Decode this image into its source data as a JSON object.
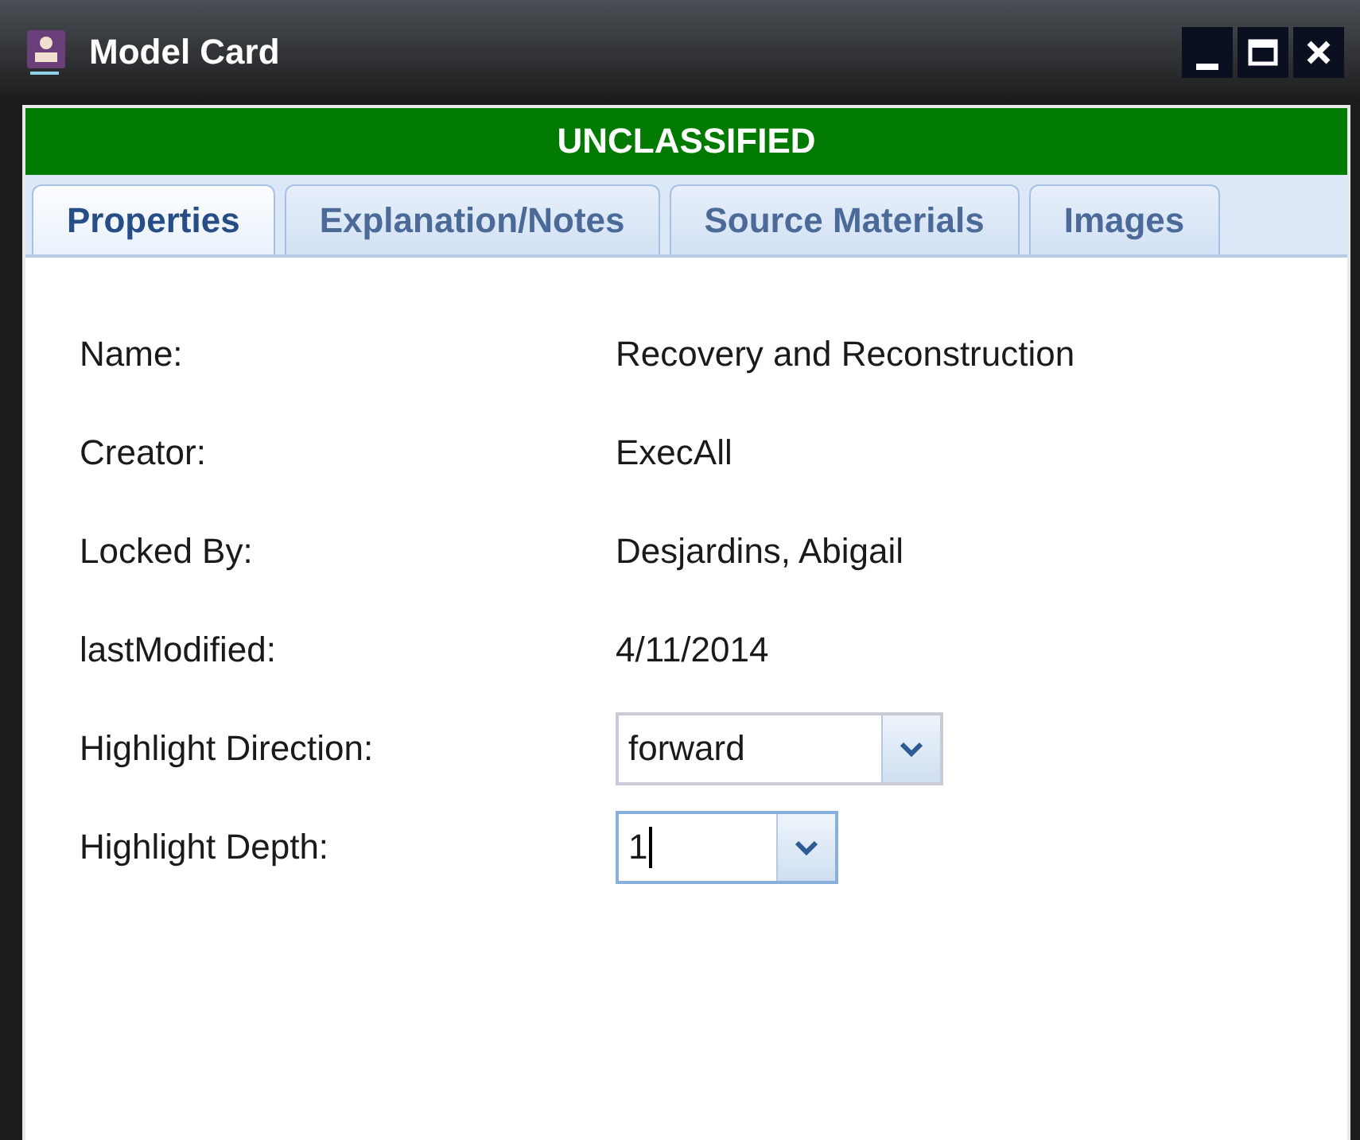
{
  "window": {
    "title": "Model Card"
  },
  "classification_banner": "UNCLASSIFIED",
  "tabs": [
    {
      "label": "Properties",
      "selected": true
    },
    {
      "label": "Explanation/Notes",
      "selected": false
    },
    {
      "label": "Source Materials",
      "selected": false
    },
    {
      "label": "Images",
      "selected": false
    }
  ],
  "properties": [
    {
      "kind": "text",
      "label": "Name:",
      "value": "Recovery and Reconstruction"
    },
    {
      "kind": "text",
      "label": "Creator:",
      "value": "ExecAll"
    },
    {
      "kind": "text",
      "label": "Locked By:",
      "value": "Desjardins, Abigail"
    },
    {
      "kind": "text",
      "label": "lastModified:",
      "value": "4/11/2014"
    },
    {
      "kind": "dropdown",
      "label": "Highlight Direction:",
      "value": "forward",
      "focused": false
    },
    {
      "kind": "dropdown",
      "label": "Highlight Depth:",
      "value": "1",
      "focused": true
    }
  ]
}
